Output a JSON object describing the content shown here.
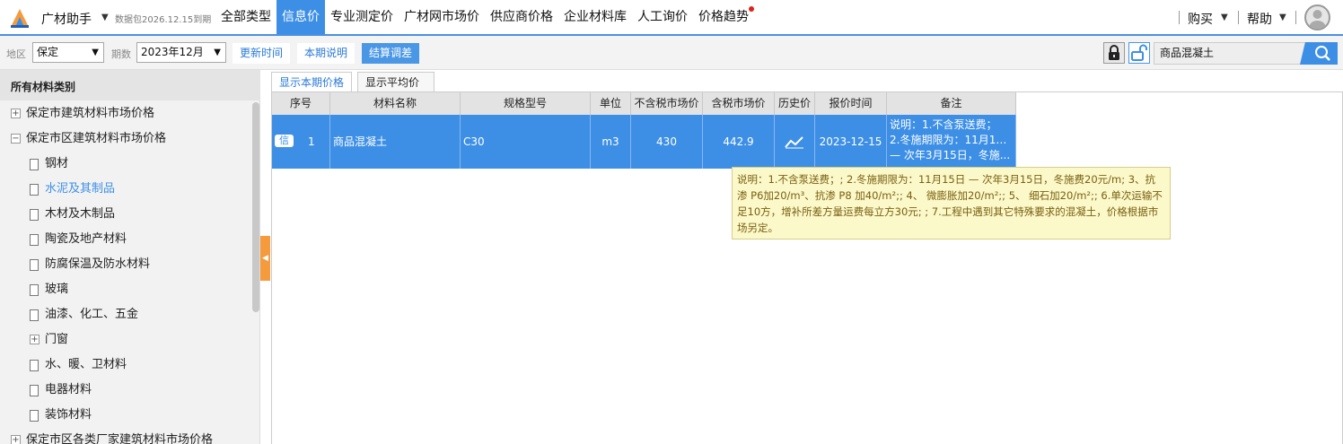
{
  "app": {
    "title": "广材助手",
    "package_note": "数据包2026.12.15到期"
  },
  "nav": {
    "items": [
      {
        "label": "全部类型",
        "active": false
      },
      {
        "label": "信息价",
        "active": true
      },
      {
        "label": "专业测定价",
        "active": false
      },
      {
        "label": "广材网市场价",
        "active": false
      },
      {
        "label": "供应商价格",
        "active": false
      },
      {
        "label": "企业材料库",
        "active": false
      },
      {
        "label": "人工询价",
        "active": false
      },
      {
        "label": "价格趋势",
        "active": false,
        "badge": true
      }
    ],
    "buy_label": "购买",
    "help_label": "帮助"
  },
  "toolbar": {
    "region_label": "地区",
    "region_value": "保定",
    "period_label": "期数",
    "period_value": "2023年12月",
    "update_time_label": "更新时间",
    "period_note_label": "本期说明",
    "settlement_label": "结算调差",
    "search_value": "商品混凝土"
  },
  "sidebar": {
    "header": "所有材料类别",
    "items": [
      {
        "label": "保定市建筑材料市场价格",
        "type": "plus",
        "level": 0
      },
      {
        "label": "保定市区建筑材料市场价格",
        "type": "minus",
        "level": 0
      },
      {
        "label": "钢材",
        "type": "doc",
        "level": 1
      },
      {
        "label": "水泥及其制品",
        "type": "doc",
        "level": 1,
        "selected": true
      },
      {
        "label": "木材及木制品",
        "type": "doc",
        "level": 1
      },
      {
        "label": "陶瓷及地产材料",
        "type": "doc",
        "level": 1
      },
      {
        "label": "防腐保温及防水材料",
        "type": "doc",
        "level": 1
      },
      {
        "label": "玻璃",
        "type": "doc",
        "level": 1
      },
      {
        "label": "油漆、化工、五金",
        "type": "doc",
        "level": 1
      },
      {
        "label": "门窗",
        "type": "plus",
        "level": 1
      },
      {
        "label": "水、暖、卫材料",
        "type": "doc",
        "level": 1
      },
      {
        "label": "电器材料",
        "type": "doc",
        "level": 1
      },
      {
        "label": "装饰材料",
        "type": "doc",
        "level": 1
      },
      {
        "label": "保定市区各类厂家建筑材料市场价格",
        "type": "plus",
        "level": 0
      }
    ]
  },
  "tabs": {
    "current": "显示本期价格",
    "average": "显示平均价"
  },
  "table": {
    "columns": [
      "序号",
      "材料名称",
      "规格型号",
      "单位",
      "不含税市场价",
      "含税市场价",
      "历史价",
      "报价时间",
      "备注"
    ],
    "rows": [
      {
        "tag": "信",
        "index": "1",
        "name": "商品混凝土",
        "spec": "C30",
        "unit": "m3",
        "price_ex_tax": "430",
        "price_inc_tax": "442.9",
        "date": "2023-12-15",
        "remark_lines": [
          "说明：1.不含泵送费；",
          "2.冬施期限为：11月15日",
          "— 次年3月15日，冬施..."
        ]
      }
    ]
  },
  "tooltip": {
    "text": "说明：1.不含泵送费；; 2.冬施期限为：11月15日 — 次年3月15日，冬施费20元/m; 3、抗渗 P6加20/m³、抗渗 P8 加40/m²;; 4、 微膨胀加20/m²;; 5、 细石加20/m²;; 6.单次运输不足10方，增补所差方量运费每立方30元; ; 7.工程中遇到其它特殊要求的混凝土，价格根据市场另定。"
  },
  "colors": {
    "accent": "#3d8fe6",
    "selected_row": "#3d8fe6",
    "collapse_tab": "#f59b3c",
    "tooltip_bg": "#fbf8c9",
    "badge": "#e0201a"
  }
}
